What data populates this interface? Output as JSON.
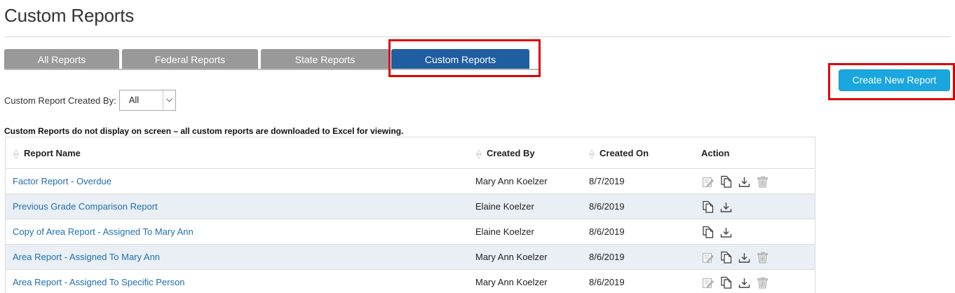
{
  "page": {
    "title": "Custom Reports"
  },
  "tabs": [
    {
      "label": "All Reports",
      "active": false
    },
    {
      "label": "Federal Reports",
      "active": false
    },
    {
      "label": "State Reports",
      "active": false
    },
    {
      "label": "Custom Reports",
      "active": true
    }
  ],
  "create_button": {
    "label": "Create New Report"
  },
  "filter": {
    "label": "Custom Report Created By:",
    "selected": "All"
  },
  "notice": "Custom Reports do not display on screen – all custom reports are downloaded to Excel for viewing.",
  "table": {
    "columns": [
      "Report Name",
      "Created By",
      "Created On",
      "Action"
    ],
    "rows": [
      {
        "name": "Factor Report - Overdue",
        "created_by": "Mary Ann Koelzer",
        "created_on": "8/7/2019",
        "actions": [
          "edit-icon",
          "copy-icon",
          "download-icon",
          "trash-icon"
        ]
      },
      {
        "name": "Previous Grade Comparison Report",
        "created_by": "Elaine Koelzer",
        "created_on": "8/6/2019",
        "actions": [
          "copy-icon",
          "download-icon"
        ]
      },
      {
        "name": "Copy of Area Report - Assigned To Mary Ann",
        "created_by": "Elaine Koelzer",
        "created_on": "8/6/2019",
        "actions": [
          "copy-icon",
          "download-icon"
        ]
      },
      {
        "name": "Area Report - Assigned To Mary Ann",
        "created_by": "Mary Ann Koelzer",
        "created_on": "8/6/2019",
        "actions": [
          "edit-icon",
          "copy-icon",
          "download-icon",
          "trash-icon"
        ]
      },
      {
        "name": "Area Report - Assigned To Specific Person",
        "created_by": "Mary Ann Koelzer",
        "created_on": "8/6/2019",
        "actions": [
          "edit-icon",
          "copy-icon",
          "download-icon",
          "trash-icon"
        ]
      }
    ]
  },
  "colors": {
    "active_tab": "#1f5ea0",
    "inactive_tab": "#999999",
    "button": "#1aa6de",
    "highlight": "#e00000",
    "link": "#1f6fae",
    "alt_row": "#e9eff5"
  }
}
